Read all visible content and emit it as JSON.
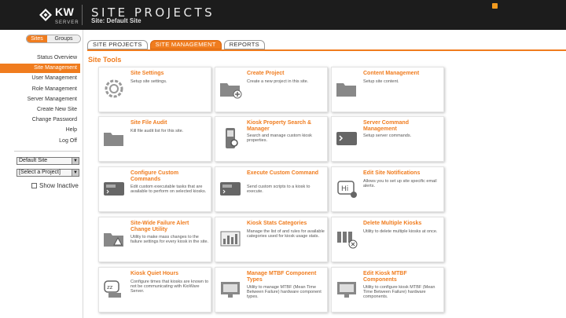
{
  "header": {
    "logo_text": "KW",
    "logo_sub": "SERVER",
    "app_title": "SITE PROJECTS",
    "site_subtitle": "Site: Default Site"
  },
  "sidebar": {
    "toggle": {
      "on": "Sites",
      "off": "Groups"
    },
    "items": [
      {
        "label": "Status Overview",
        "active": false
      },
      {
        "label": "Site Management",
        "active": true
      },
      {
        "label": "User Management",
        "active": false
      },
      {
        "label": "Role Management",
        "active": false
      },
      {
        "label": "Server Management",
        "active": false
      },
      {
        "label": "Create New Site",
        "active": false
      },
      {
        "label": "Change Password",
        "active": false
      },
      {
        "label": "Help",
        "active": false
      },
      {
        "label": "Log Off",
        "active": false
      }
    ],
    "site_select": "Default Site",
    "project_select": "[Select a Project]",
    "show_inactive_label": "Show Inactive"
  },
  "tabs": [
    {
      "label": "SITE PROJECTS",
      "active": false
    },
    {
      "label": "SITE MANAGEMENT",
      "active": true
    },
    {
      "label": "REPORTS",
      "active": false
    }
  ],
  "section_title": "Site Tools",
  "tiles": [
    {
      "title": "Site Settings",
      "desc": "Setup site settings.",
      "icon": "gear-icon"
    },
    {
      "title": "Create Project",
      "desc": "Create a new project in this site.",
      "icon": "folder-add-icon"
    },
    {
      "title": "Content Management",
      "desc": "Setup site content.",
      "icon": "folder-icon"
    },
    {
      "title": "Site File Audit",
      "desc": "Kill file audit list for this site.",
      "icon": "folder-icon"
    },
    {
      "title": "Kiosk Property Search & Manager",
      "desc": "Search and manage custom kiosk properties.",
      "icon": "kiosk-search-icon"
    },
    {
      "title": "Server Command Management",
      "desc": "Setup server commands.",
      "icon": "terminal-icon"
    },
    {
      "title": "Configure Custom Commands",
      "desc": "Edit custom executable tasks that are available to perform on selected kiosks.",
      "icon": "custom-command-icon"
    },
    {
      "title": "Execute Custom Command",
      "desc": "Send custom scripts to a kiosk to execute.",
      "icon": "custom-command-icon"
    },
    {
      "title": "Edit Site Notifications",
      "desc": "Allows you to set up site specific email alerts.",
      "icon": "notification-icon"
    },
    {
      "title": "Site-Wide Failure Alert Change Utility",
      "desc": "Utility to make mass changes to the failure settings for every kiosk in the site.",
      "icon": "alert-folder-icon"
    },
    {
      "title": "Kiosk Stats Categories",
      "desc": "Manage the list of and rules for available categories used for kiosk usage stats.",
      "icon": "stats-icon"
    },
    {
      "title": "Delete Multiple Kiosks",
      "desc": "Utility to delete multiple kiosks at once.",
      "icon": "delete-kiosk-icon"
    },
    {
      "title": "Kiosk Quiet Hours",
      "desc": "Configure times that kiosks are known to not be communicating with KioWare Server.",
      "icon": "sleep-icon"
    },
    {
      "title": "Manage MTBF Component Types",
      "desc": "Utility to manage MTBF (Mean Time Between Failure) hardware component types.",
      "icon": "monitor-icon"
    },
    {
      "title": "Edit Kiosk MTBF Components",
      "desc": "Utility to configure kiosk MTBF (Mean Time Between Failure) hardware components.",
      "icon": "monitor-icon"
    }
  ],
  "colors": {
    "accent": "#f07c1e",
    "header_bg": "#1c1c1c"
  }
}
